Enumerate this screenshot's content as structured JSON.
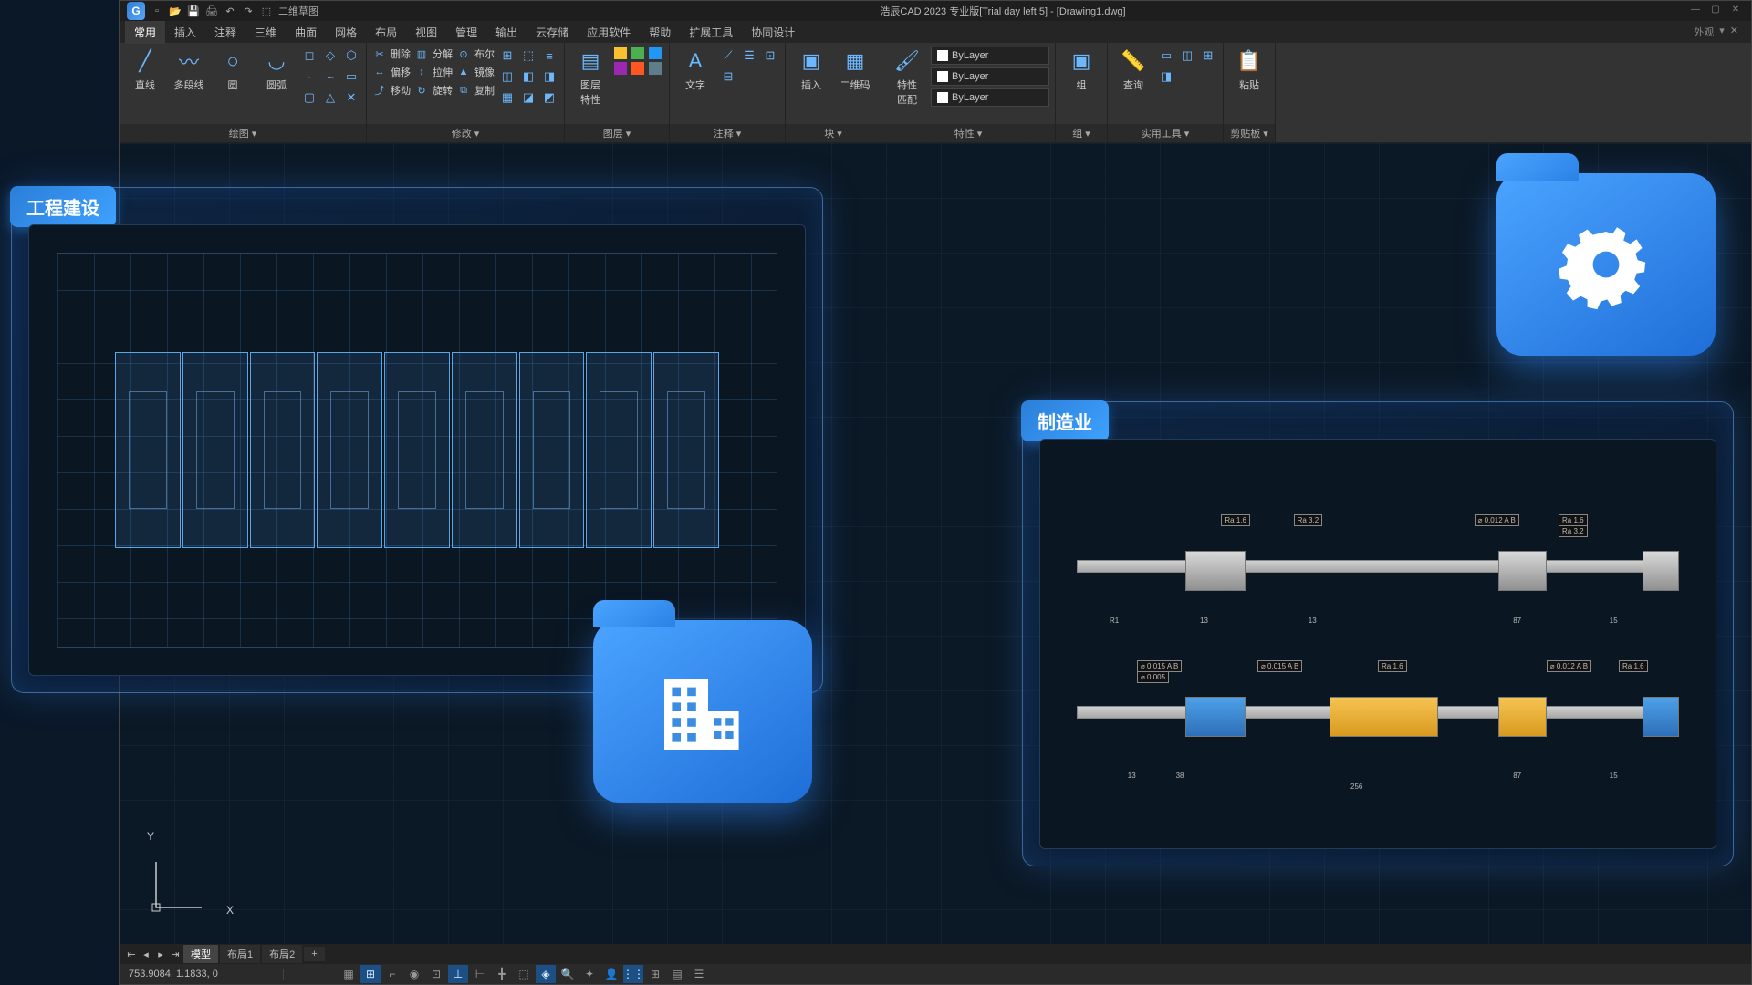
{
  "window": {
    "title": "浩辰CAD 2023 专业版[Trial day left 5] - [Drawing1.dwg]",
    "logo_letter": "G",
    "workspace": "二维草图"
  },
  "ribbon": {
    "tabs": [
      "常用",
      "插入",
      "注释",
      "三维",
      "曲面",
      "网格",
      "布局",
      "视图",
      "管理",
      "输出",
      "云存储",
      "应用软件",
      "帮助",
      "扩展工具",
      "协同设计"
    ],
    "active_tab_index": 0,
    "right_label": "外观",
    "panels": [
      {
        "title": "绘图",
        "big": [
          {
            "label": "直线",
            "glyph": "╱"
          },
          {
            "label": "多段线",
            "glyph": "〰"
          },
          {
            "label": "圆",
            "glyph": "○"
          },
          {
            "label": "圆弧",
            "glyph": "◡"
          }
        ],
        "small": [
          "◻",
          "◇",
          "⬡",
          "·",
          "~",
          "▭",
          "▢",
          "△",
          "✕"
        ]
      },
      {
        "title": "修改",
        "rows": [
          {
            "ico": "✂",
            "label": "删除"
          },
          {
            "ico": "↔",
            "label": "偏移"
          },
          {
            "ico": "⤴",
            "label": "移动"
          }
        ],
        "rows2": [
          {
            "ico": "▥",
            "label": "分解"
          },
          {
            "ico": "↕",
            "label": "拉伸"
          },
          {
            "ico": "↻",
            "label": "旋转"
          }
        ],
        "rows3": [
          {
            "ico": "⊙",
            "label": "布尔"
          },
          {
            "ico": "▲",
            "label": "镜像"
          },
          {
            "ico": "⧉",
            "label": "复制"
          }
        ],
        "small": [
          "⊞",
          "⬚",
          "≡",
          "◫",
          "◧",
          "◨",
          "▦",
          "◪",
          "◩"
        ]
      },
      {
        "title": "图层",
        "big": [
          {
            "label": "图层\n特性",
            "glyph": "▤"
          }
        ],
        "swatches": [
          "#fbc02d",
          "#4CAF50",
          "#2196F3",
          "#9C27B0",
          "#FF5722",
          "#607D8B"
        ]
      },
      {
        "title": "注释",
        "big": [
          {
            "label": "文字",
            "glyph": "A"
          }
        ],
        "small": [
          "⟋",
          "☰",
          "⊡",
          "⊟"
        ]
      },
      {
        "title": "块",
        "big": [
          {
            "label": "插入",
            "glyph": "▣"
          },
          {
            "label": "二维码",
            "glyph": "▦"
          }
        ]
      },
      {
        "title": "特性",
        "big": [
          {
            "label": "特性\n匹配",
            "glyph": "🖌"
          }
        ],
        "fields": [
          "ByLayer",
          "ByLayer",
          "ByLayer"
        ]
      },
      {
        "title": "组",
        "big": [
          {
            "label": "组",
            "glyph": "▣"
          }
        ]
      },
      {
        "title": "实用工具",
        "big": [
          {
            "label": "查询",
            "glyph": "📏"
          }
        ],
        "small": [
          "▭",
          "◫",
          "⊞",
          "◨"
        ]
      },
      {
        "title": "剪贴板",
        "big": [
          {
            "label": "粘贴",
            "glyph": "📋"
          }
        ]
      }
    ]
  },
  "layout_tabs": {
    "tabs": [
      "模型",
      "布局1",
      "布局2"
    ],
    "plus": "+",
    "active": 0
  },
  "status": {
    "coords": "753.9084, 1.1833, 0"
  },
  "ucs": {
    "x_label": "X",
    "y_label": "Y"
  },
  "cards": {
    "architecture": "工程建设",
    "manufacturing": "制造业"
  },
  "shaft_annotations": {
    "top": [
      "Ra 1.6",
      "Ra 3.2",
      "⌀ 0.012 A B",
      "Ra 1.6",
      "Ra 3.2"
    ],
    "dims_top": [
      "R1",
      "13",
      "13",
      "87",
      "15"
    ],
    "bottom_tol": [
      "⌀ 0.015 A B",
      "⌀ 0.005",
      "⌀ 0.015 A B",
      "⌀ 0.012 A B"
    ],
    "bottom_ra": [
      "Ra 1.6",
      "Ra 1.6"
    ],
    "dims_bottom": [
      "13",
      "38",
      "256",
      "87",
      "15"
    ]
  }
}
